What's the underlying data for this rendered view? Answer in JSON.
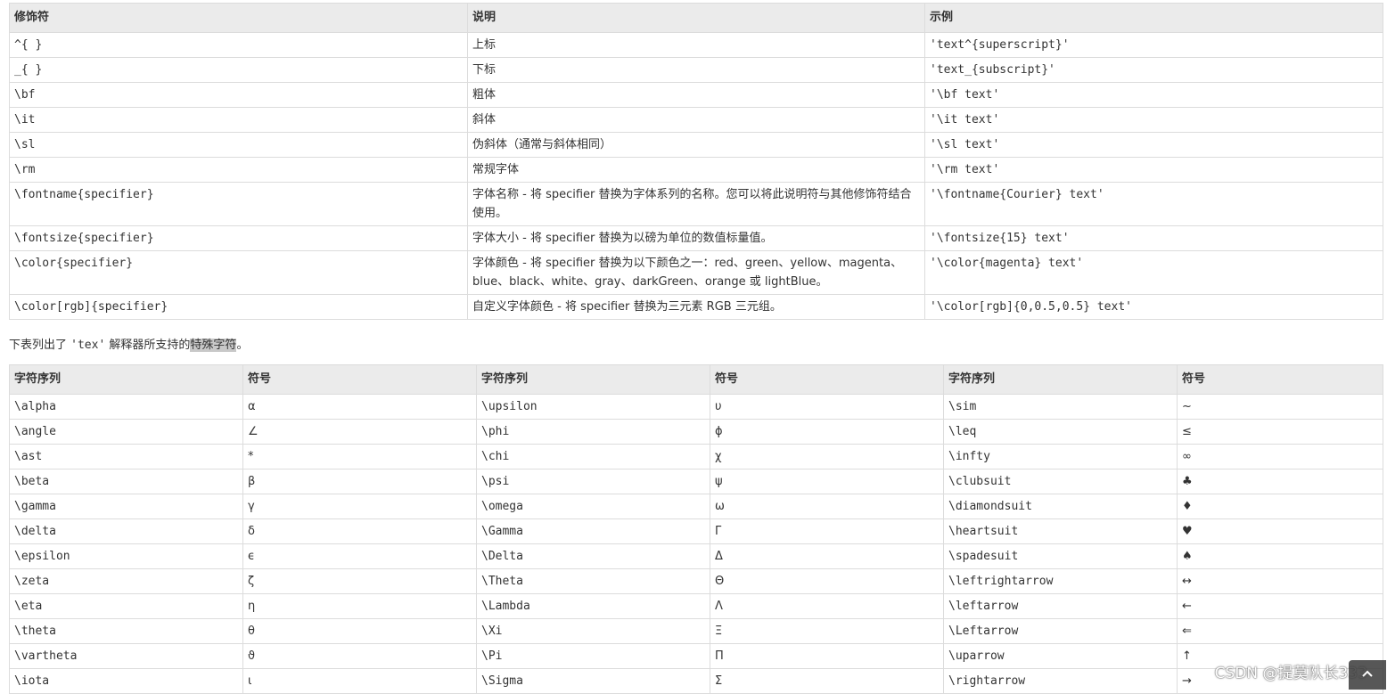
{
  "modifiers": {
    "headers": [
      "修饰符",
      "说明",
      "示例"
    ],
    "rows": [
      {
        "mod": "^{ }",
        "desc": "上标",
        "example": "'text^{superscript}'"
      },
      {
        "mod": "_{ }",
        "desc": "下标",
        "example": "'text_{subscript}'"
      },
      {
        "mod": "\\bf",
        "desc": "粗体",
        "example": "'\\bf text'"
      },
      {
        "mod": "\\it",
        "desc": "斜体",
        "example": "'\\it text'"
      },
      {
        "mod": "\\sl",
        "desc": "伪斜体（通常与斜体相同）",
        "example": "'\\sl text'"
      },
      {
        "mod": "\\rm",
        "desc": "常规字体",
        "example": "'\\rm text'"
      },
      {
        "mod": "\\fontname{specifier}",
        "desc": "字体名称 - 将 specifier 替换为字体系列的名称。您可以将此说明符与其他修饰符结合使用。",
        "example": "'\\fontname{Courier} text'"
      },
      {
        "mod": "\\fontsize{specifier}",
        "desc": "字体大小 - 将 specifier 替换为以磅为单位的数值标量值。",
        "example": "'\\fontsize{15} text'"
      },
      {
        "mod": "\\color{specifier}",
        "desc": "字体颜色 - 将 specifier 替换为以下颜色之一：red、green、yellow、magenta、blue、black、white、gray、darkGreen、orange 或 lightBlue。",
        "example": "'\\color{magenta} text'"
      },
      {
        "mod": "\\color[rgb]{specifier}",
        "desc": "自定义字体颜色 - 将 specifier 替换为三元素 RGB 三元组。",
        "example": "'\\color[rgb]{0,0.5,0.5} text'"
      }
    ]
  },
  "paragraph": {
    "before": "下表列出了 ",
    "code": "'tex'",
    "middle": " 解释器所支持的",
    "highlight": "特殊字符",
    "after": "。"
  },
  "symbols": {
    "headers": [
      "字符序列",
      "符号",
      "字符序列",
      "符号",
      "字符序列",
      "符号"
    ],
    "rows": [
      [
        "\\alpha",
        "α",
        "\\upsilon",
        "υ",
        "\\sim",
        "~"
      ],
      [
        "\\angle",
        "∠",
        "\\phi",
        "ϕ",
        "\\leq",
        "≤"
      ],
      [
        "\\ast",
        "*",
        "\\chi",
        "χ",
        "\\infty",
        "∞"
      ],
      [
        "\\beta",
        "β",
        "\\psi",
        "ψ",
        "\\clubsuit",
        "♣"
      ],
      [
        "\\gamma",
        "γ",
        "\\omega",
        "ω",
        "\\diamondsuit",
        "♦"
      ],
      [
        "\\delta",
        "δ",
        "\\Gamma",
        "Γ",
        "\\heartsuit",
        "♥"
      ],
      [
        "\\epsilon",
        "ϵ",
        "\\Delta",
        "Δ",
        "\\spadesuit",
        "♠"
      ],
      [
        "\\zeta",
        "ζ",
        "\\Theta",
        "Θ",
        "\\leftrightarrow",
        "↔"
      ],
      [
        "\\eta",
        "η",
        "\\Lambda",
        "Λ",
        "\\leftarrow",
        "←"
      ],
      [
        "\\theta",
        "θ",
        "\\Xi",
        "Ξ",
        "\\Leftarrow",
        "⇐"
      ],
      [
        "\\vartheta",
        "ϑ",
        "\\Pi",
        "Π",
        "\\uparrow",
        "↑"
      ],
      [
        "\\iota",
        "ι",
        "\\Sigma",
        "Σ",
        "\\rightarrow",
        "→"
      ]
    ]
  },
  "watermark": "CSDN @提莫队长333",
  "back_to_top_icon": "chevron-up-icon"
}
